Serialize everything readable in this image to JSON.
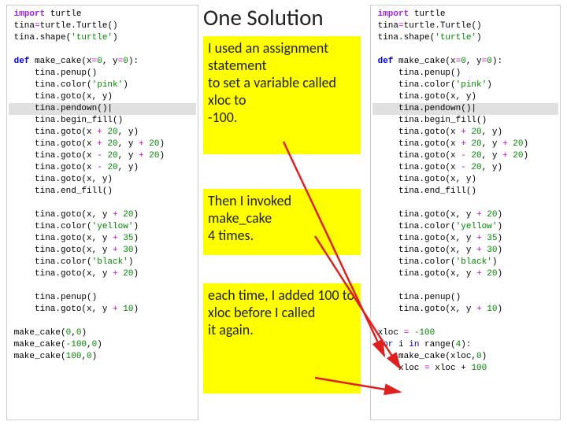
{
  "title": "One Solution",
  "box1": "I used an assignment statement\nto set a variable called xloc to\n-100.",
  "box2": "Then I invoked make_cake\n4 times.",
  "box3": "each time, I added 100 to xloc before I called\nit again.",
  "code_common_head": [
    {
      "t": "import",
      "cls": "kw-import",
      "post": " turtle"
    },
    {
      "raw": "tina",
      "post": "",
      "eq": true,
      "after": "turtle.Turtle()"
    },
    {
      "raw": "tina.shape(",
      "str": "'turtle'",
      "post": ")"
    }
  ],
  "code_fn": {
    "def_sig": "make_cake(x",
    "eq1": "=",
    "num1": "0",
    "mid": ", y",
    "eq2": "=",
    "num2": "0",
    "end": "):",
    "body": [
      "    tina.penup()",
      "    tina.color('pink')",
      "    tina.goto(x, y)",
      "    tina.pendown()|",
      "    tina.begin_fill()",
      "    tina.goto(x + 20, y)",
      "    tina.goto(x + 20, y + 20)",
      "    tina.goto(x - 20, y + 20)",
      "    tina.goto(x - 20, y)",
      "    tina.goto(x, y)",
      "    tina.end_fill()",
      "",
      "    tina.goto(x, y + 20)",
      "    tina.color('yellow')",
      "    tina.goto(x, y + 35)",
      "    tina.goto(x, y + 30)",
      "    tina.color('black')",
      "    tina.goto(x, y + 20)",
      "",
      "    tina.penup()",
      "    tina.goto(x, y + 10)"
    ]
  },
  "left_calls": [
    "make_cake(0,0)",
    "make_cake(-100,0)",
    "make_cake(100,0)"
  ],
  "right_loop": {
    "l1_a": "xloc ",
    "l1_eq": "=",
    "l1_b": " ",
    "l1_num": "-100",
    "l2_for": "for",
    "l2_mid": " i ",
    "l2_in": "in",
    "l2_range": " range(",
    "l2_num": "4",
    "l2_end": "):",
    "l3": "    make_cake(xloc,",
    "l3_num": "0",
    "l3_end": ")",
    "l4_a": "    xloc ",
    "l4_eq": "=",
    "l4_b": " xloc + ",
    "l4_num": "100"
  }
}
